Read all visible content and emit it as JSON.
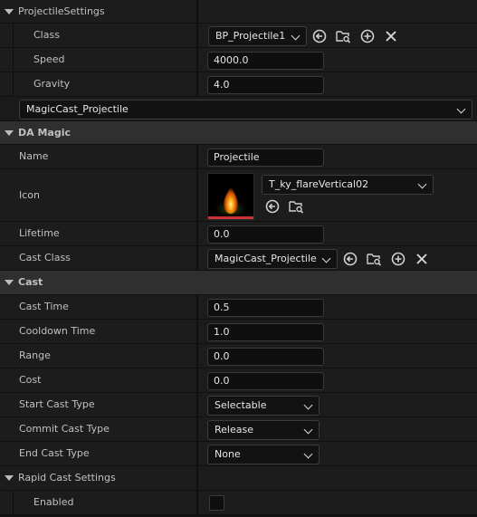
{
  "projectile_settings": {
    "header": "ProjectileSettings",
    "class_label": "Class",
    "class_value": "BP_Projectile1",
    "speed_label": "Speed",
    "speed_value": "4000.0",
    "gravity_label": "Gravity",
    "gravity_value": "4.0",
    "asset_value": "MagicCast_Projectile"
  },
  "da_magic": {
    "header": "DA Magic",
    "name_label": "Name",
    "name_value": "Projectile",
    "icon_label": "Icon",
    "icon_texture": "T_ky_flareVertical02",
    "lifetime_label": "Lifetime",
    "lifetime_value": "0.0",
    "cast_class_label": "Cast Class",
    "cast_class_value": "MagicCast_Projectile"
  },
  "cast": {
    "header": "Cast",
    "cast_time_label": "Cast Time",
    "cast_time_value": "0.5",
    "cooldown_label": "Cooldown Time",
    "cooldown_value": "1.0",
    "range_label": "Range",
    "range_value": "0.0",
    "cost_label": "Cost",
    "cost_value": "0.0",
    "start_type_label": "Start Cast Type",
    "start_type_value": "Selectable",
    "commit_type_label": "Commit Cast Type",
    "commit_type_value": "Release",
    "end_type_label": "End Cast Type",
    "end_type_value": "None",
    "rapid_label": "Rapid Cast Settings",
    "enabled_label": "Enabled",
    "enabled_checked": false
  },
  "colors": {
    "background": "#151515",
    "row": "#1c1c1c",
    "header": "#2f2f2f",
    "icon_preview_bar": "#c83232"
  },
  "icons": [
    "dropdown-triangle-icon",
    "chevron-down-icon",
    "use-selected-icon",
    "browse-folder-icon",
    "add-plus-icon",
    "clear-x-icon"
  ]
}
